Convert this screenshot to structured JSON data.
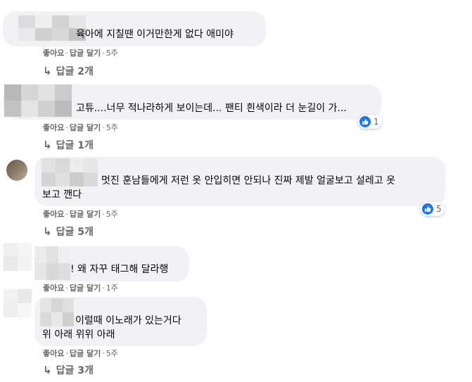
{
  "colors": {
    "bubble_bg": "#f0f2f5",
    "meta_text": "#65676b",
    "like_blue": "#1877f2",
    "text": "#050505"
  },
  "comments": [
    {
      "text": "육아에 지칠땐 이거만한게 없다 애미야",
      "actions": {
        "like": "좋아요",
        "reply": "답글 달기",
        "time": "5주"
      },
      "replies_label": "답글 2개"
    },
    {
      "text": "고튜....너무 적나라하게 보이는데... 팬티 흰색이라 더 눈길이 가...",
      "reaction_count": "1",
      "actions": {
        "like": "좋아요",
        "reply": "답글 달기",
        "time": "5주"
      },
      "replies_label": "답글 1개"
    },
    {
      "text_line1": "멋진 훈남들에게 저런 옷 안입히면 안되나 진짜 제발 얼굴보고 설레고 옷",
      "text_line2": "보고 깬다",
      "reaction_count": "5",
      "actions": {
        "like": "좋아요",
        "reply": "답글 달기",
        "time": "5주"
      },
      "replies_label": "답글 5개"
    },
    {
      "text": "! 왜 자꾸 태그해 달라행",
      "actions": {
        "like": "좋아요",
        "reply": "답글 달기",
        "time": "1주"
      }
    },
    {
      "text_line1": "이럴때 이노래가 있는거다",
      "text_line2": "위 아래 위위 아래",
      "actions": {
        "like": "좋아요",
        "reply": "답글 달기",
        "time": "5주"
      },
      "replies_label": "답글 3개"
    }
  ]
}
